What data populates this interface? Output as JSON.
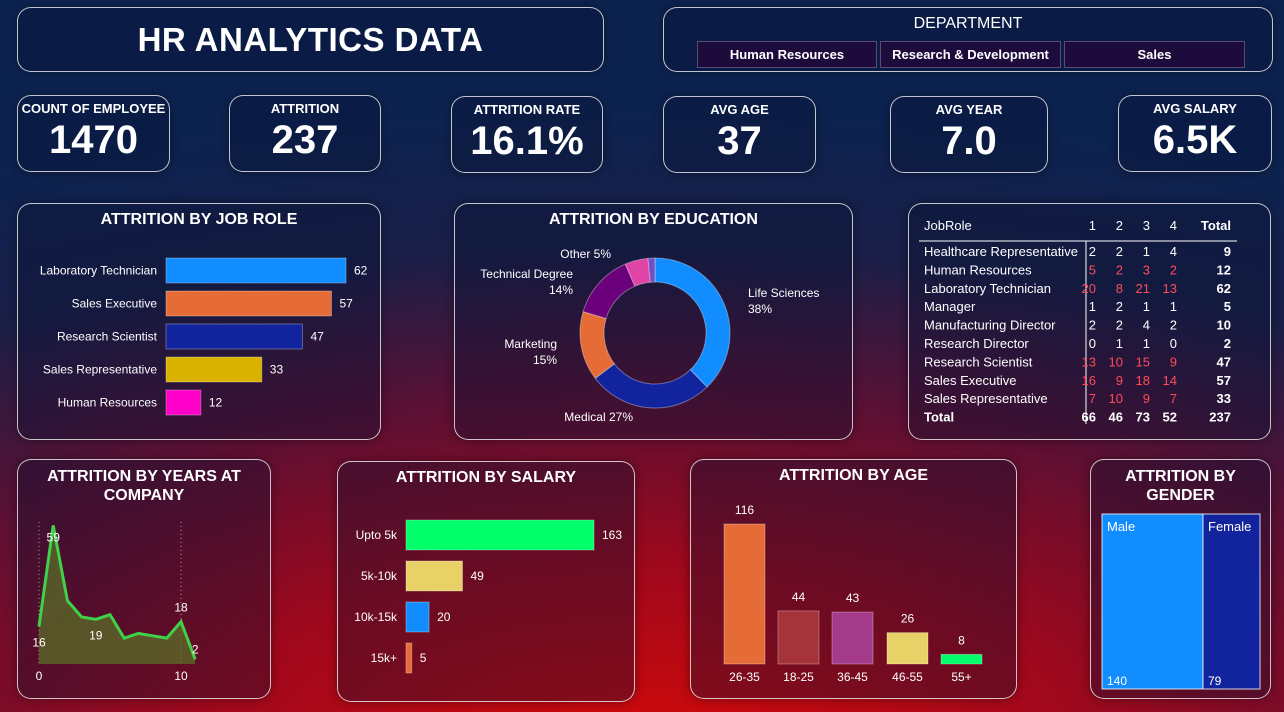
{
  "header": {
    "title": "HR ANALYTICS DATA"
  },
  "department": {
    "label": "DEPARTMENT",
    "options": [
      "Human Resources",
      "Research & Development",
      "Sales"
    ]
  },
  "kpis": [
    {
      "label": "COUNT OF EMPLOYEE",
      "value": "1470"
    },
    {
      "label": "ATTRITION",
      "value": "237"
    },
    {
      "label": "ATTRITION RATE",
      "value": "16.1%"
    },
    {
      "label": "AVG AGE",
      "value": "37"
    },
    {
      "label": "AVG YEAR",
      "value": "7.0"
    },
    {
      "label": "AVG SALARY",
      "value": "6.5K"
    }
  ],
  "job_role_title": "ATTRITION BY JOB ROLE",
  "education_title": "ATTRITION BY EDUCATION",
  "years_title_1": "ATTRITION BY YEARS AT",
  "years_title_2": "COMPANY",
  "salary_title": "ATTRITION BY SALARY",
  "age_title": "ATTRITION BY AGE",
  "gender_title_1": "ATTRITION BY",
  "gender_title_2": "GENDER",
  "colors": {
    "blue": "#118dff",
    "orange": "#e66c37",
    "navy": "#12239e",
    "gold": "#d9b300",
    "magenta": "#e044a7",
    "purple": "#6b007b",
    "violet": "#744ec2",
    "green": "#00ff6a",
    "khaki": "#e8d166",
    "crimson": "#a4343a",
    "plum": "#a43a8a",
    "line": "#3fd14a"
  },
  "chart_data": [
    {
      "type": "bar",
      "title": "ATTRITION BY JOB ROLE",
      "categories": [
        "Laboratory Technician",
        "Sales Executive",
        "Research Scientist",
        "Sales Representative",
        "Human Resources"
      ],
      "values": [
        62,
        57,
        47,
        33,
        12
      ],
      "colors": [
        "#118dff",
        "#e66c37",
        "#12239e",
        "#d9b300",
        "#ff00c8"
      ]
    },
    {
      "type": "pie",
      "title": "ATTRITION BY EDUCATION",
      "slices": [
        {
          "label": "Life Sciences",
          "pct": "38%",
          "value": 38,
          "color": "#118dff"
        },
        {
          "label": "Medical",
          "pct": "27%",
          "value": 27,
          "color": "#12239e"
        },
        {
          "label": "Marketing",
          "pct": "15%",
          "value": 15,
          "color": "#e66c37"
        },
        {
          "label": "Technical Degree",
          "pct": "14%",
          "value": 14,
          "color": "#6b007b"
        },
        {
          "label": "Other",
          "pct": "5%",
          "value": 5,
          "color": "#e044a7"
        },
        {
          "label": "",
          "pct": "",
          "value": 1.5,
          "color": "#744ec2"
        }
      ]
    },
    {
      "type": "table",
      "columns": [
        "JobRole",
        "1",
        "2",
        "3",
        "4",
        "Total"
      ],
      "rows": [
        [
          "Healthcare Representative",
          2,
          2,
          1,
          4,
          9
        ],
        [
          "Human Resources",
          5,
          2,
          3,
          2,
          12
        ],
        [
          "Laboratory Technician",
          20,
          8,
          21,
          13,
          62
        ],
        [
          "Manager",
          1,
          2,
          1,
          1,
          5
        ],
        [
          "Manufacturing Director",
          2,
          2,
          4,
          2,
          10
        ],
        [
          "Research Director",
          0,
          1,
          1,
          0,
          2
        ],
        [
          "Research Scientist",
          13,
          10,
          15,
          9,
          47
        ],
        [
          "Sales Executive",
          16,
          9,
          18,
          14,
          57
        ],
        [
          "Sales Representative",
          7,
          10,
          9,
          7,
          33
        ]
      ],
      "total": [
        "Total",
        66,
        46,
        73,
        52,
        237
      ]
    },
    {
      "type": "area",
      "title": "ATTRITION BY YEARS AT COMPANY",
      "x": [
        0,
        1,
        2,
        3,
        4,
        5,
        6,
        7,
        8,
        9,
        10,
        11
      ],
      "values": [
        16,
        59,
        27,
        20,
        19,
        21,
        11,
        13,
        12,
        11,
        18,
        2
      ],
      "labels": {
        "0": "16",
        "1": "59",
        "4": "19",
        "10": "18",
        "11": "2"
      },
      "xticks": [
        0,
        10
      ],
      "ylim": [
        0,
        60
      ]
    },
    {
      "type": "bar",
      "title": "ATTRITION BY SALARY",
      "categories": [
        "Upto 5k",
        "5k-10k",
        "10k-15k",
        "15k+"
      ],
      "values": [
        163,
        49,
        20,
        5
      ],
      "colors": [
        "#00ff6a",
        "#e8d166",
        "#118dff",
        "#e66c37"
      ]
    },
    {
      "type": "bar",
      "title": "ATTRITION BY AGE",
      "categories": [
        "26-35",
        "18-25",
        "36-45",
        "46-55",
        "55+"
      ],
      "values": [
        116,
        44,
        43,
        26,
        8
      ],
      "colors": [
        "#e66c37",
        "#a4343a",
        "#a43a8a",
        "#e8d166",
        "#00ff6a"
      ]
    },
    {
      "type": "heatmap",
      "title": "ATTRITION BY GENDER",
      "items": [
        {
          "label": "Male",
          "value": 140,
          "color": "#118dff"
        },
        {
          "label": "Female",
          "value": 79,
          "color": "#12239e"
        }
      ]
    }
  ]
}
